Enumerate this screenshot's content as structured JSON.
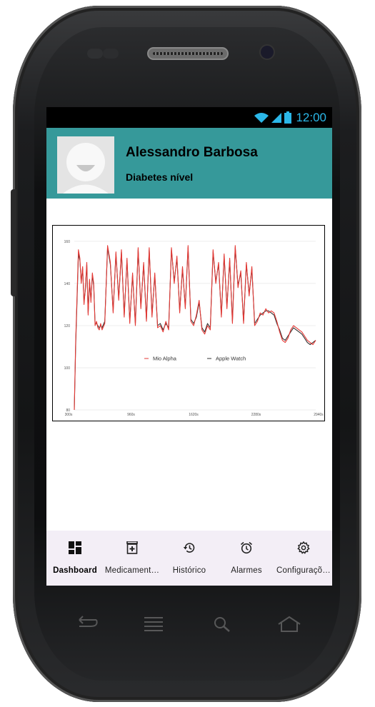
{
  "status_bar": {
    "time": "12:00"
  },
  "profile": {
    "name": "Alessandro Barbosa",
    "subtitle": "Diabetes nível"
  },
  "chart_data": {
    "type": "line",
    "xlabel": "",
    "ylabel": "",
    "ylim": [
      80,
      162
    ],
    "xlim": [
      300,
      2040
    ],
    "x_ticks": [
      "300s",
      "960s",
      "1620s",
      "2280s",
      "2940s"
    ],
    "y_ticks": [
      "80",
      "100",
      "120",
      "140",
      "160"
    ],
    "grid": true,
    "legend_position": "bottom-center",
    "series": [
      {
        "name": "Mio Alpha",
        "color": "#e53935",
        "x": [
          300,
          310,
          330,
          340,
          350,
          360,
          370,
          380,
          390,
          400,
          410,
          420,
          430,
          440,
          450,
          460,
          470,
          480,
          490,
          500,
          520,
          540,
          560,
          580,
          600,
          620,
          640,
          660,
          680,
          700,
          720,
          740,
          760,
          780,
          800,
          820,
          840,
          860,
          880,
          900,
          920,
          940,
          960,
          980,
          1000,
          1020,
          1040,
          1060,
          1080,
          1100,
          1120,
          1140,
          1160,
          1180,
          1200,
          1220,
          1240,
          1260,
          1280,
          1300,
          1320,
          1340,
          1360,
          1380,
          1400,
          1420,
          1440,
          1460,
          1480,
          1500,
          1520,
          1540,
          1560,
          1580,
          1600,
          1620,
          1640,
          1660,
          1680,
          1700,
          1720,
          1740,
          1760,
          1780,
          1800,
          1820,
          1840,
          1860,
          1880,
          1900,
          1920,
          1940,
          1960,
          1980,
          2000,
          2020,
          2040
        ],
        "y": [
          80,
          112,
          156,
          152,
          140,
          148,
          130,
          138,
          150,
          125,
          142,
          131,
          145,
          140,
          120,
          122,
          119,
          118,
          121,
          118,
          121,
          158,
          150,
          126,
          155,
          132,
          156,
          124,
          152,
          121,
          145,
          120,
          157,
          128,
          150,
          122,
          157,
          124,
          145,
          119,
          120,
          117,
          122,
          118,
          157,
          140,
          153,
          126,
          148,
          128,
          158,
          122,
          120,
          125,
          132,
          118,
          116,
          120,
          118,
          156,
          140,
          150,
          124,
          154,
          128,
          152,
          121,
          158,
          138,
          146,
          121,
          150,
          134,
          148,
          120,
          122,
          126,
          125,
          128,
          126,
          127,
          126,
          122,
          117,
          113,
          112,
          114,
          118,
          120,
          119,
          118,
          117,
          115,
          113,
          112,
          111,
          113
        ]
      },
      {
        "name": "Apple Watch",
        "color": "#333333",
        "x": [
          300,
          310,
          330,
          340,
          350,
          360,
          370,
          380,
          390,
          400,
          410,
          420,
          430,
          440,
          450,
          460,
          470,
          480,
          490,
          500,
          520,
          540,
          560,
          580,
          600,
          620,
          640,
          660,
          680,
          700,
          720,
          740,
          760,
          780,
          800,
          820,
          840,
          860,
          880,
          900,
          920,
          940,
          960,
          980,
          1000,
          1020,
          1040,
          1060,
          1080,
          1100,
          1120,
          1140,
          1160,
          1180,
          1200,
          1220,
          1240,
          1260,
          1280,
          1300,
          1320,
          1340,
          1360,
          1380,
          1400,
          1420,
          1440,
          1460,
          1480,
          1500,
          1520,
          1540,
          1560,
          1580,
          1600,
          1620,
          1640,
          1660,
          1680,
          1700,
          1720,
          1740,
          1760,
          1780,
          1800,
          1820,
          1840,
          1860,
          1880,
          1900,
          1920,
          1940,
          1960,
          1980,
          2000,
          2020,
          2040
        ],
        "y": [
          80,
          110,
          154,
          151,
          141,
          147,
          131,
          137,
          149,
          126,
          141,
          132,
          144,
          139,
          121,
          121,
          120,
          119,
          120,
          119,
          122,
          157,
          149,
          127,
          154,
          133,
          155,
          125,
          151,
          122,
          144,
          121,
          156,
          129,
          149,
          123,
          156,
          125,
          144,
          120,
          121,
          118,
          121,
          119,
          156,
          141,
          152,
          127,
          147,
          129,
          157,
          123,
          121,
          124,
          131,
          119,
          117,
          121,
          119,
          155,
          141,
          149,
          125,
          153,
          129,
          151,
          122,
          157,
          139,
          145,
          122,
          149,
          135,
          147,
          121,
          123,
          125,
          126,
          127,
          127,
          126,
          125,
          121,
          118,
          114,
          113,
          115,
          117,
          119,
          118,
          117,
          116,
          114,
          112,
          111,
          112,
          113
        ]
      }
    ]
  },
  "nav": {
    "items": [
      {
        "label": "Dashboard",
        "icon": "dashboard-icon",
        "active": true
      },
      {
        "label": "Medicament…",
        "icon": "medication-icon",
        "active": false
      },
      {
        "label": "Histórico",
        "icon": "history-icon",
        "active": false
      },
      {
        "label": "Alarmes",
        "icon": "alarm-icon",
        "active": false
      },
      {
        "label": "Configuraçõ…",
        "icon": "settings-icon",
        "active": false
      }
    ]
  },
  "colors": {
    "header": "#36999a",
    "status_icons": "#2bb7e8",
    "nav_bg": "#f3eef6"
  }
}
